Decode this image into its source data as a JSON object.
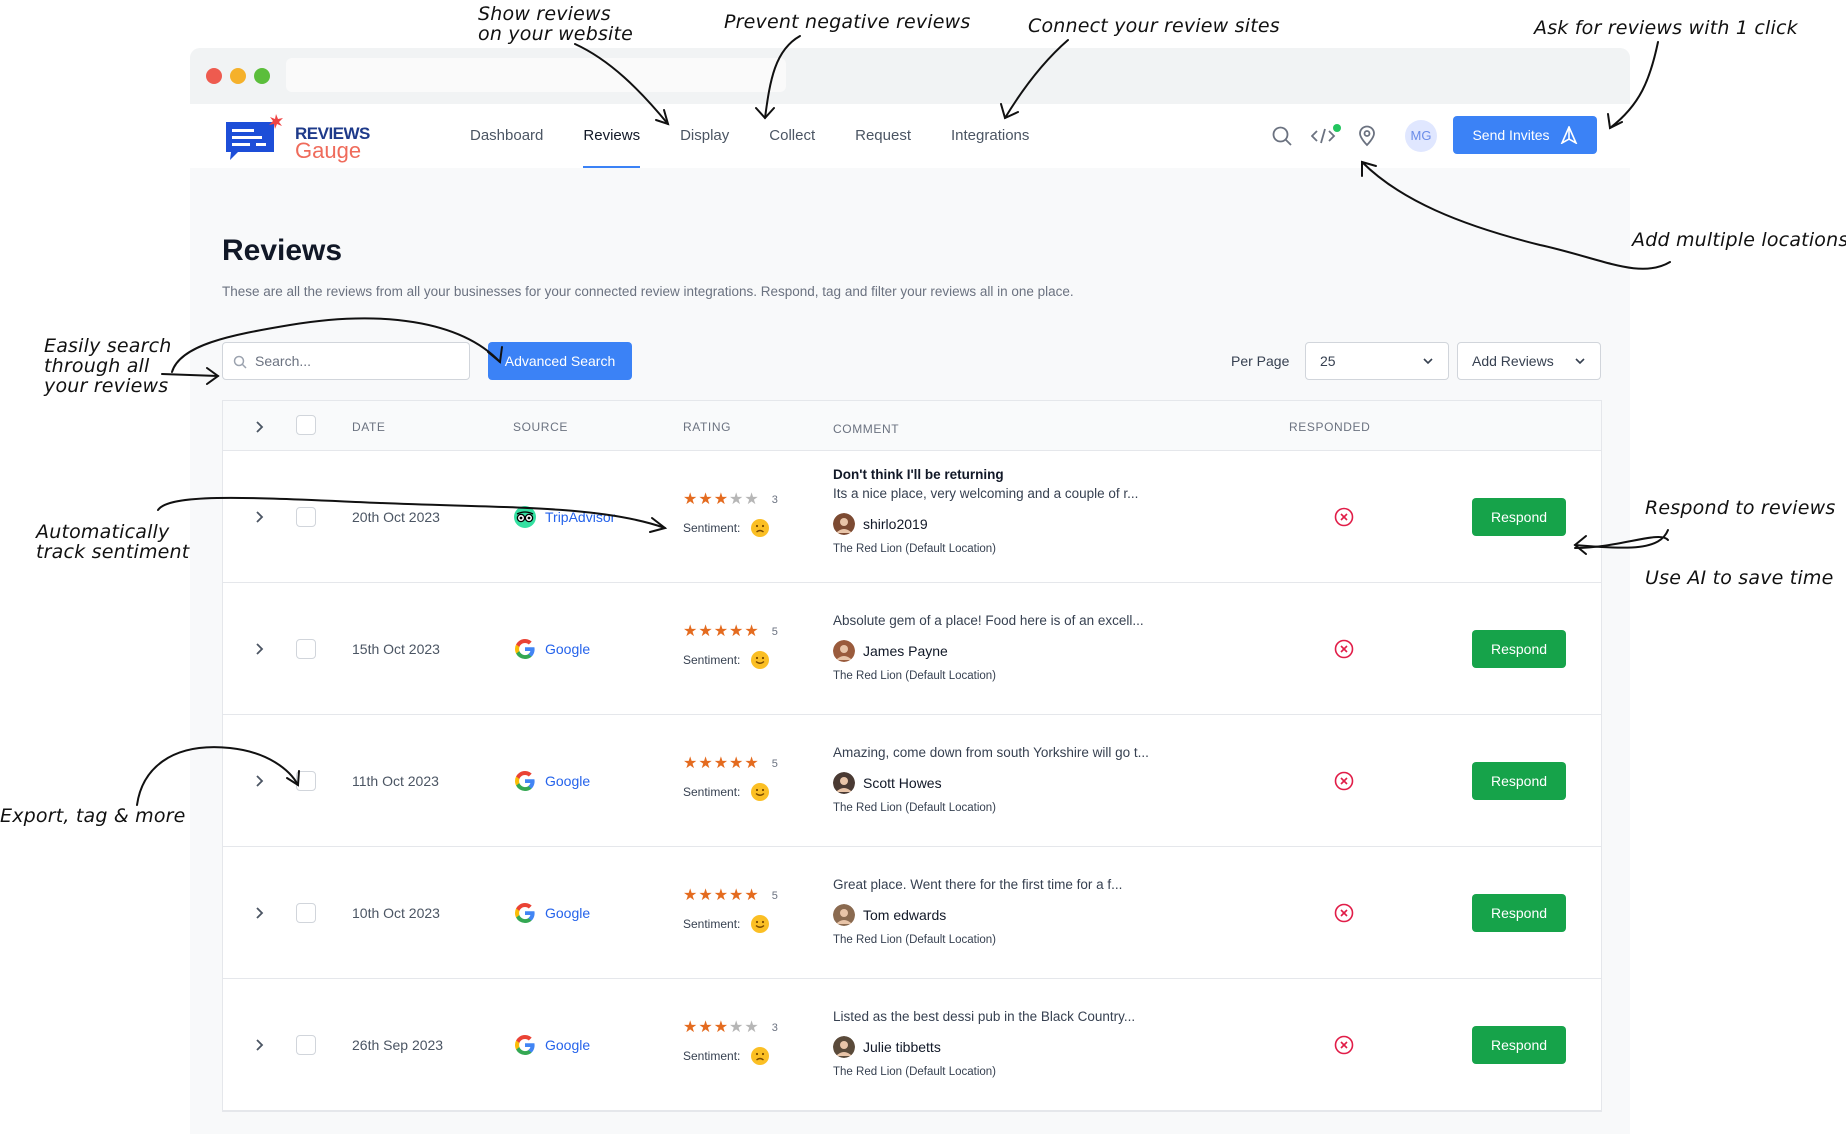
{
  "annotations": {
    "show_reviews": [
      "Show reviews",
      "on your website"
    ],
    "prevent_negative": "Prevent negative reviews",
    "connect_sites": "Connect your review sites",
    "ask_reviews": "Ask for reviews with 1 click",
    "add_locations": "Add multiple locations",
    "easily_search": [
      "Easily search",
      "through all",
      "your reviews"
    ],
    "track_sentiment": [
      "Automatically",
      "track sentiment"
    ],
    "respond": "Respond to reviews",
    "use_ai": "Use AI to save time",
    "export": "Export, tag & more"
  },
  "logo": {
    "line1": "REVIEWS",
    "line2": "Gauge"
  },
  "nav": {
    "links": [
      "Dashboard",
      "Reviews",
      "Display",
      "Collect",
      "Request",
      "Integrations"
    ],
    "active": "Reviews",
    "avatar_initials": "MG",
    "send_invites": "Send Invites",
    "status_dot_color": "#22c55e"
  },
  "page": {
    "title": "Reviews",
    "description": "These are all the reviews from all your businesses for your connected review integrations. Respond, tag and filter your reviews all in one place."
  },
  "toolbar": {
    "search_placeholder": "Search...",
    "advanced_search": "Advanced Search",
    "per_page_label": "Per Page",
    "per_page_value": "25",
    "add_reviews": "Add Reviews"
  },
  "table": {
    "headers": {
      "date": "DATE",
      "source": "SOURCE",
      "rating": "RATING",
      "comment": "COMMENT",
      "responded": "RESPONDED"
    },
    "sentiment_label": "Sentiment:",
    "respond_label": "Respond",
    "rows": [
      {
        "date": "20th Oct 2023",
        "source": "TripAdvisor",
        "source_icon": "tripadvisor-icon",
        "rating": 3,
        "rating_text": "3",
        "sentiment": "negative",
        "title": "Don't think I'll be returning",
        "comment": "Its a nice place, very welcoming and a couple of r...",
        "reviewer": "shirlo2019",
        "location": "The Red Lion (Default Location)",
        "responded": false
      },
      {
        "date": "15th Oct 2023",
        "source": "Google",
        "source_icon": "google-icon",
        "rating": 5,
        "rating_text": "5",
        "sentiment": "positive",
        "title": "",
        "comment": "Absolute gem of a place! Food here is of an excell...",
        "reviewer": "James Payne",
        "location": "The Red Lion (Default Location)",
        "responded": false
      },
      {
        "date": "11th Oct 2023",
        "source": "Google",
        "source_icon": "google-icon",
        "rating": 5,
        "rating_text": "5",
        "sentiment": "positive",
        "title": "",
        "comment": "Amazing, come down from south Yorkshire will go t...",
        "reviewer": "Scott Howes",
        "location": "The Red Lion (Default Location)",
        "responded": false
      },
      {
        "date": "10th Oct 2023",
        "source": "Google",
        "source_icon": "google-icon",
        "rating": 5,
        "rating_text": "5",
        "sentiment": "positive",
        "title": "",
        "comment": "Great place. Went there for the first time for a f...",
        "reviewer": "Tom edwards",
        "location": "The Red Lion (Default Location)",
        "responded": false
      },
      {
        "date": "26th Sep 2023",
        "source": "Google",
        "source_icon": "google-icon",
        "rating": 3,
        "rating_text": "3",
        "sentiment": "negative",
        "title": "",
        "comment": "Listed as the best dessi pub in the Black Country...",
        "reviewer": "Julie tibbetts",
        "location": "The Red Lion (Default Location)",
        "responded": false
      }
    ]
  },
  "colors": {
    "primary": "#3b82f6",
    "respond": "#16a34a",
    "star": "#e46b1f",
    "not_responded": "#e11d48"
  }
}
